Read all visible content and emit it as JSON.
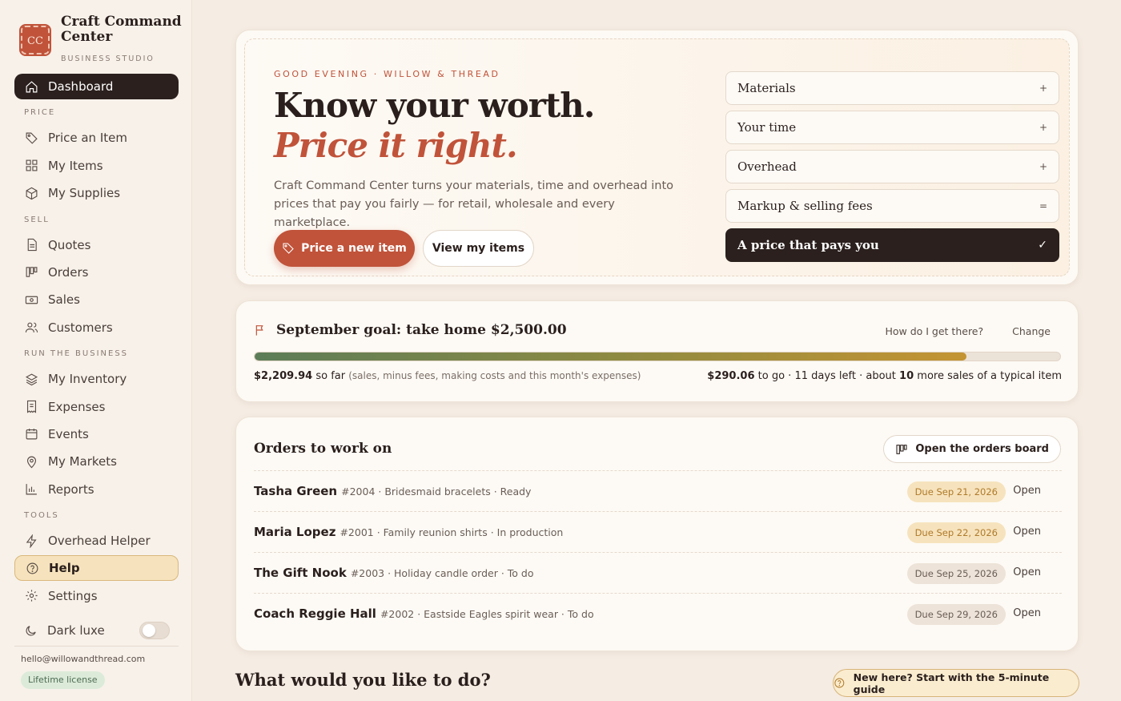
{
  "brand": {
    "logo_text": "CC",
    "name": "Craft Command Center",
    "subtitle": "BUSINESS STUDIO"
  },
  "nav": {
    "dashboard": "Dashboard",
    "section_price": "PRICE",
    "price_item": "Price an Item",
    "my_items": "My Items",
    "my_supplies": "My Supplies",
    "section_sell": "SELL",
    "quotes": "Quotes",
    "orders": "Orders",
    "sales": "Sales",
    "customers": "Customers",
    "section_run": "RUN THE BUSINESS",
    "inventory": "My Inventory",
    "expenses": "Expenses",
    "events": "Events",
    "markets": "My Markets",
    "reports": "Reports",
    "section_tools": "TOOLS",
    "overhead": "Overhead Helper",
    "help": "Help",
    "settings": "Settings",
    "active": "dashboard"
  },
  "sidebar_footer": {
    "dark_mode_label": "Dark luxe",
    "dark_mode_on": false,
    "email": "hello@willowandthread.com",
    "license": "Lifetime license"
  },
  "hero": {
    "eyebrow": "GOOD EVENING · WILLOW & THREAD",
    "headline": "Know your worth.",
    "headline_accent": "Price it right.",
    "lede": "Craft Command Center turns your materials, time and overhead into prices that pay you fairly — for retail, wholesale and every marketplace.",
    "primary_button": "Price a new item",
    "secondary_button": "View my items",
    "steps": [
      {
        "label": "Materials",
        "symbol": "+"
      },
      {
        "label": "Your time",
        "symbol": "+"
      },
      {
        "label": "Overhead",
        "symbol": "+"
      },
      {
        "label": "Markup & selling fees",
        "symbol": "="
      },
      {
        "label": "A price that pays you",
        "symbol": "✓"
      }
    ]
  },
  "goal": {
    "title": "September goal: take home $2,500.00",
    "link_how": "How do I get there?",
    "link_change": "Change",
    "progress_fraction": 0.884,
    "so_far_amount": "$2,209.94",
    "so_far_label": "so far",
    "so_far_note": "(sales, minus fees, making costs and this month's expenses)",
    "to_go_amount": "$290.06",
    "to_go_text": "to go · 11 days left · about",
    "more_sales_count": "10",
    "more_sales_text": "more sales of a typical item"
  },
  "orders": {
    "title": "Orders to work on",
    "board_button": "Open the orders board",
    "open_label": "Open",
    "rows": [
      {
        "name": "Tasha Green",
        "meta": "#2004 · Bridesmaid bracelets · Ready",
        "due": "Due Sep 21, 2026"
      },
      {
        "name": "Maria Lopez",
        "meta": "#2001 · Family reunion shirts · In production",
        "due": "Due Sep 22, 2026"
      },
      {
        "name": "The Gift Nook",
        "meta": "#2003 · Holiday candle order · To do",
        "due": "Due Sep 25, 2026"
      },
      {
        "name": "Coach Reggie Hall",
        "meta": "#2002 · Eastside Eagles spirit wear · To do",
        "due": "Due Sep 29, 2026"
      }
    ]
  },
  "bottom": {
    "title": "What would you like to do?",
    "guide_button": "New here? Start with the 5-minute guide"
  },
  "colors": {
    "accent": "#c0533a",
    "dark": "#2b201d",
    "gold": "#f6e3bd",
    "background": "#f5ece3"
  }
}
